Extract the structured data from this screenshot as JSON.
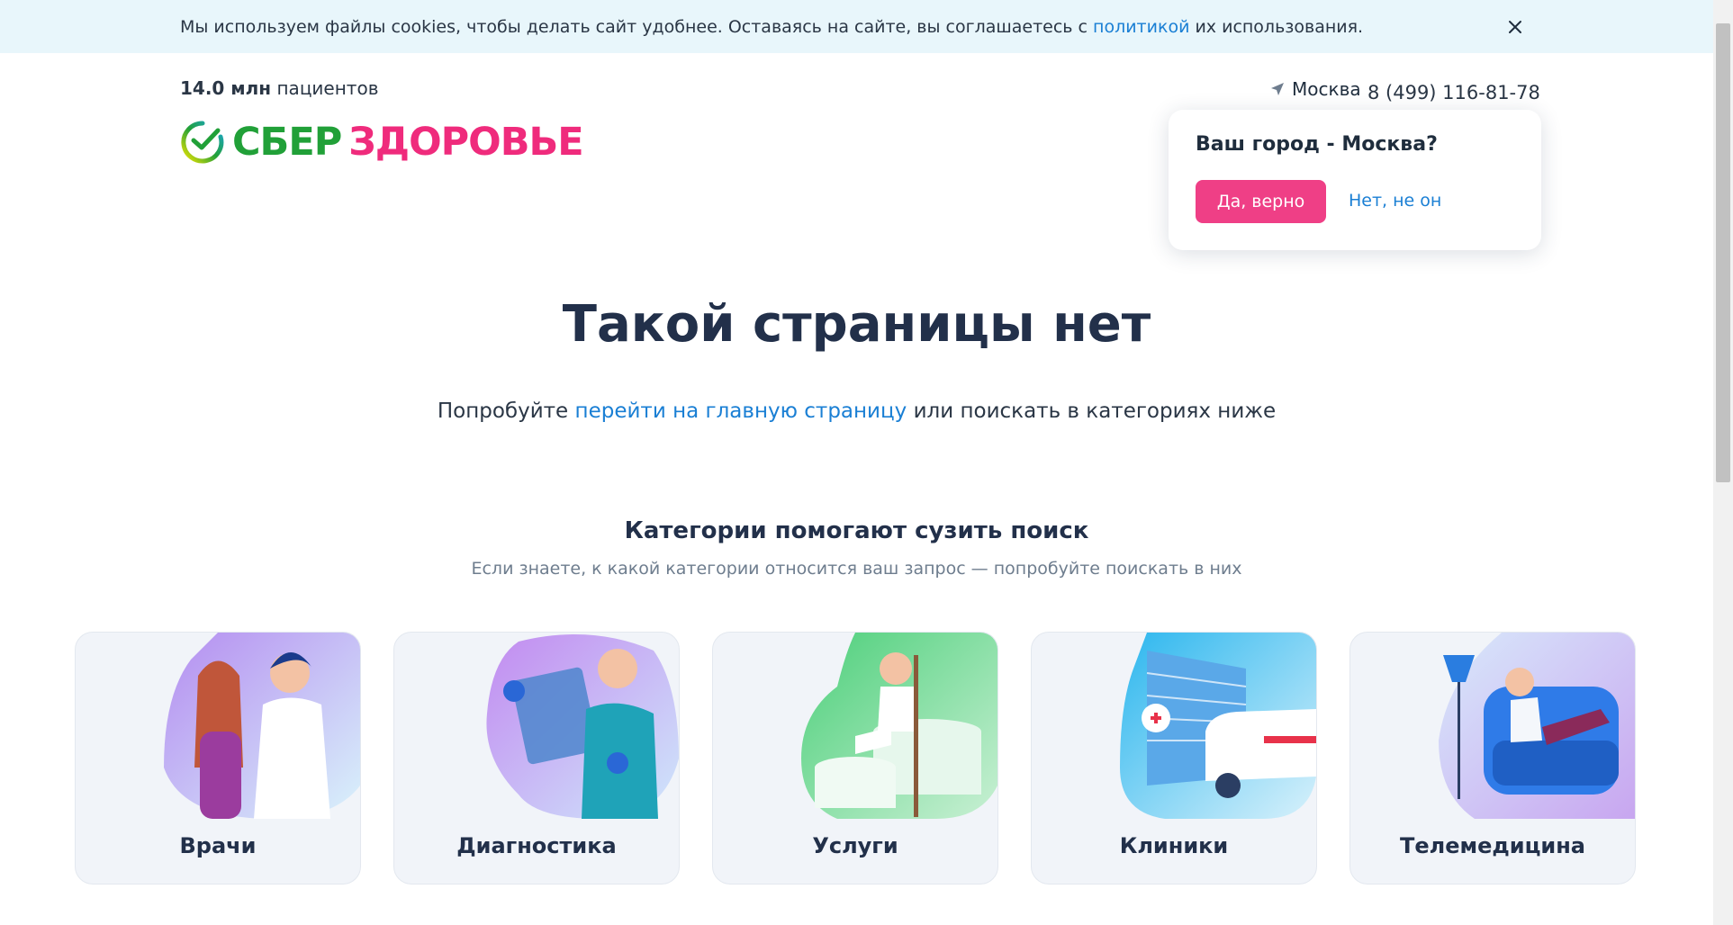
{
  "cookie": {
    "text_before": "Мы используем файлы cookies, чтобы делать сайт удобнее. Оставаясь на сайте, вы соглашаетесь с ",
    "link": "политикой",
    "text_after": " их использования."
  },
  "header": {
    "patients_count": "14.0 млн",
    "patients_label": " пациентов",
    "logo_sber": "СБЕР",
    "logo_health": "ЗДОРОВЬЕ",
    "city": "Москва",
    "phone": "8 (499) 116-81-78"
  },
  "city_popup": {
    "question": "Ваш город - Москва?",
    "yes": "Да, верно",
    "no": "Нет, не он"
  },
  "main": {
    "title": "Такой страницы нет",
    "subtitle_before": "Попробуйте ",
    "subtitle_link": "перейти на главную страницу",
    "subtitle_after": " или поискать в категориях ниже"
  },
  "categories": {
    "title": "Категории помогают сузить поиск",
    "subtitle": "Если знаете, к какой категории относится ваш запрос — попробуйте поискать в них",
    "items": [
      {
        "label": "Врачи"
      },
      {
        "label": "Диагностика"
      },
      {
        "label": "Услуги"
      },
      {
        "label": "Клиники"
      },
      {
        "label": "Телемедицина"
      }
    ]
  },
  "colors": {
    "brand_green": "#21a038",
    "brand_pink": "#ef2b7c",
    "link_blue": "#1a7fd4",
    "cookie_bg": "#e8f6fb"
  }
}
